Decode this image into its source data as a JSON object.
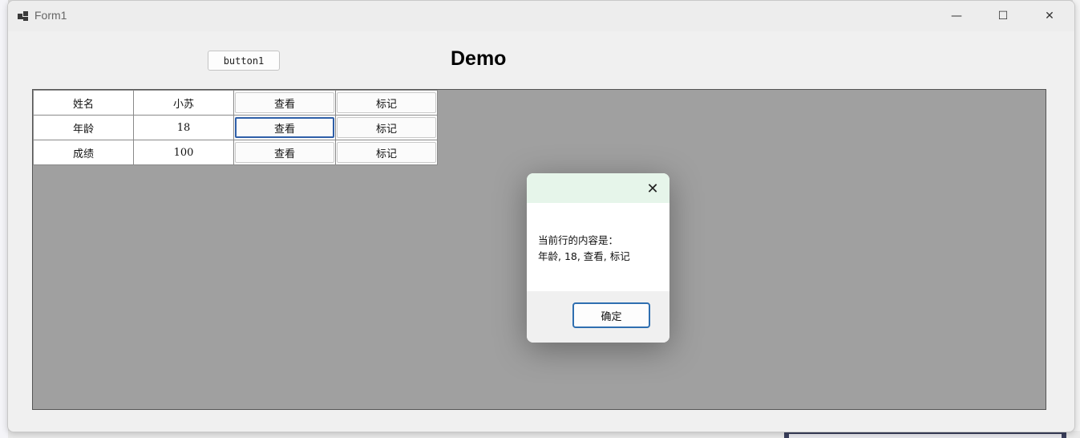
{
  "window": {
    "title": "Form1",
    "minimize_symbol": "—",
    "maximize_symbol": "☐",
    "close_symbol": "✕"
  },
  "form": {
    "button1_label": "button1",
    "demo_label": "Demo"
  },
  "grid": {
    "rows": [
      {
        "col1": "姓名",
        "col2": "小苏",
        "view": "查看",
        "mark": "标记"
      },
      {
        "col1": "年龄",
        "col2": "18",
        "view": "查看",
        "mark": "标记"
      },
      {
        "col1": "成绩",
        "col2": "100",
        "view": "查看",
        "mark": "标记"
      }
    ],
    "focused_row": 1
  },
  "dialog": {
    "close_symbol": "✕",
    "message_line1": "当前行的内容是：",
    "message_line2": "年龄, 18, 查看, 标记",
    "ok_label": "确定"
  },
  "colors": {
    "dialog_header": "#e6f5ea",
    "grid_background": "#a0a0a0",
    "focus_accent": "#2f5fa8"
  }
}
